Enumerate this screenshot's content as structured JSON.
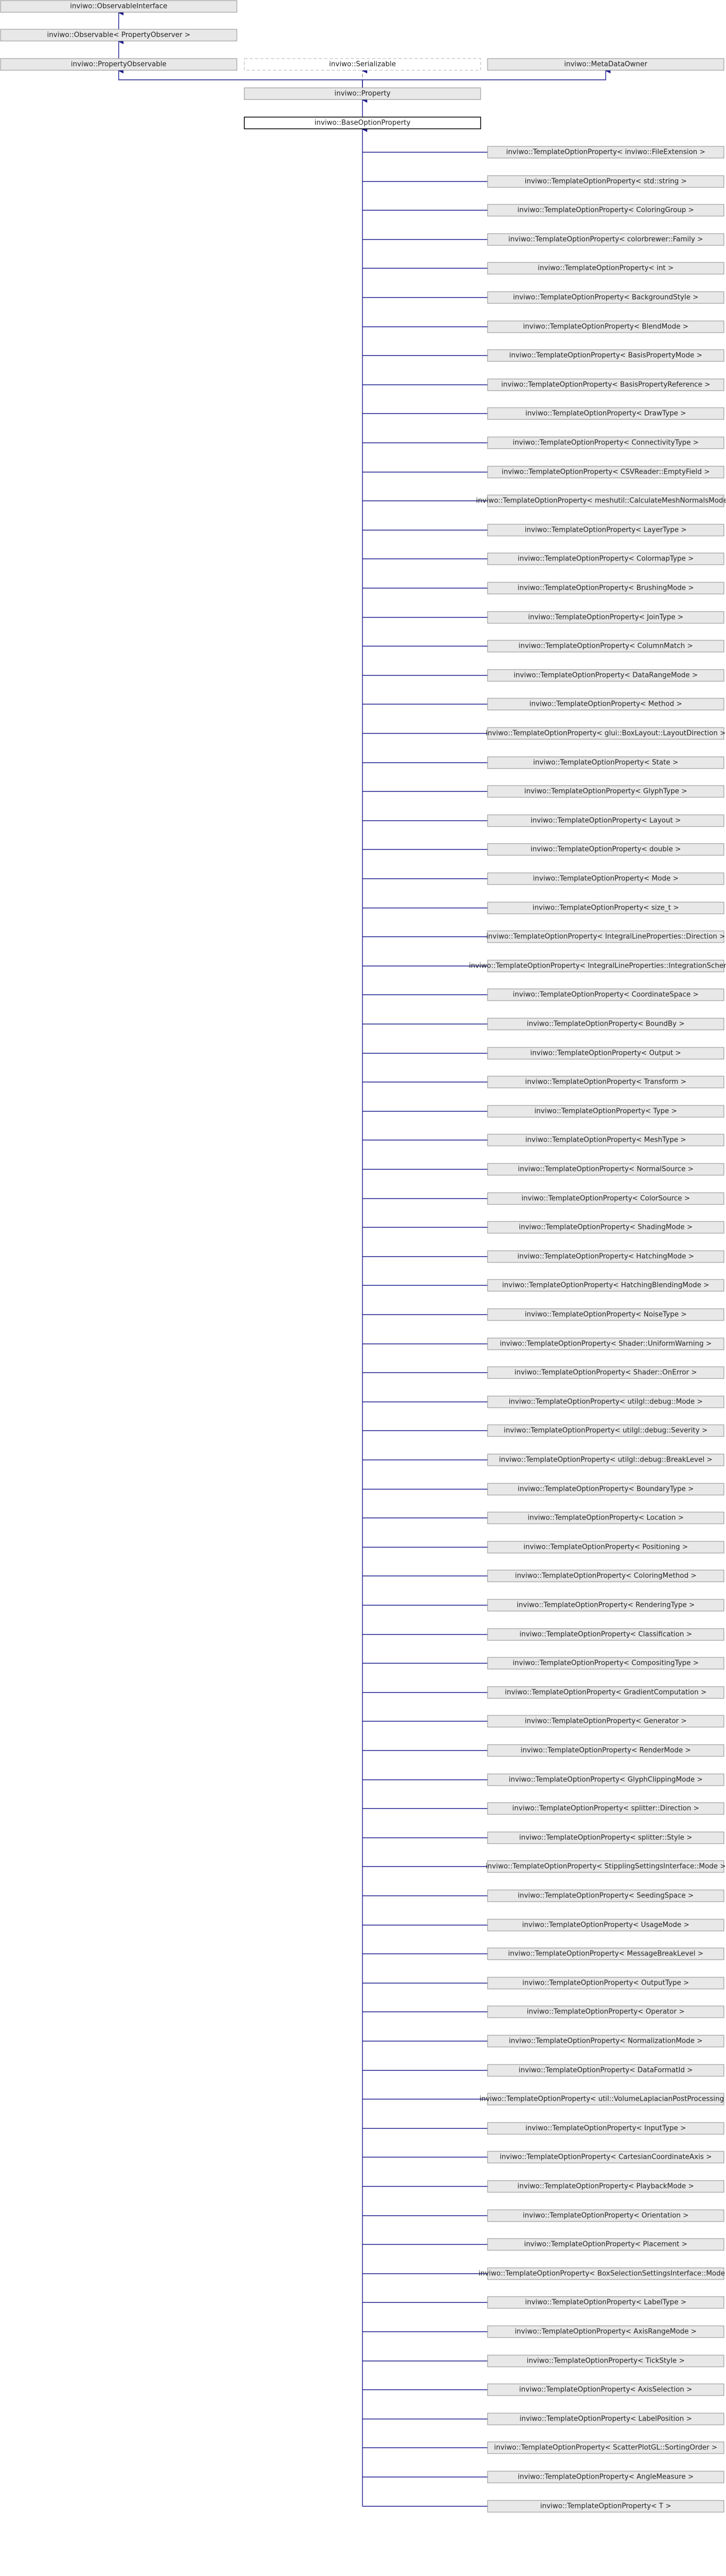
{
  "diagram": {
    "top_nodes": [
      {
        "id": "observable-interface",
        "label": "inviwo::ObservableInterface"
      },
      {
        "id": "observable-property-observer",
        "label": "inviwo::Observable< PropertyObserver >"
      },
      {
        "id": "property-observable",
        "label": "inviwo::PropertyObservable"
      },
      {
        "id": "serializable",
        "label": "inviwo::Serializable"
      },
      {
        "id": "metadata-owner",
        "label": "inviwo::MetaDataOwner"
      },
      {
        "id": "property",
        "label": "inviwo::Property"
      },
      {
        "id": "base-option-property",
        "label": "inviwo::BaseOptionProperty"
      }
    ],
    "derived": [
      "inviwo::TemplateOptionProperty< inviwo::FileExtension >",
      "inviwo::TemplateOptionProperty< std::string >",
      "inviwo::TemplateOptionProperty< ColoringGroup >",
      "inviwo::TemplateOptionProperty< colorbrewer::Family >",
      "inviwo::TemplateOptionProperty< int >",
      "inviwo::TemplateOptionProperty< BackgroundStyle >",
      "inviwo::TemplateOptionProperty< BlendMode >",
      "inviwo::TemplateOptionProperty< BasisPropertyMode >",
      "inviwo::TemplateOptionProperty< BasisPropertyReference >",
      "inviwo::TemplateOptionProperty< DrawType >",
      "inviwo::TemplateOptionProperty< ConnectivityType >",
      "inviwo::TemplateOptionProperty< CSVReader::EmptyField >",
      "inviwo::TemplateOptionProperty< meshutil::CalculateMeshNormalsMode >",
      "inviwo::TemplateOptionProperty< LayerType >",
      "inviwo::TemplateOptionProperty< ColormapType >",
      "inviwo::TemplateOptionProperty< BrushingMode >",
      "inviwo::TemplateOptionProperty< JoinType >",
      "inviwo::TemplateOptionProperty< ColumnMatch >",
      "inviwo::TemplateOptionProperty< DataRangeMode >",
      "inviwo::TemplateOptionProperty< Method >",
      "inviwo::TemplateOptionProperty< glui::BoxLayout::LayoutDirection >",
      "inviwo::TemplateOptionProperty< State >",
      "inviwo::TemplateOptionProperty< GlyphType >",
      "inviwo::TemplateOptionProperty< Layout >",
      "inviwo::TemplateOptionProperty< double >",
      "inviwo::TemplateOptionProperty< Mode >",
      "inviwo::TemplateOptionProperty< size_t >",
      "inviwo::TemplateOptionProperty< IntegralLineProperties::Direction >",
      "inviwo::TemplateOptionProperty< IntegralLineProperties::IntegrationScheme >",
      "inviwo::TemplateOptionProperty< CoordinateSpace >",
      "inviwo::TemplateOptionProperty< BoundBy >",
      "inviwo::TemplateOptionProperty< Output >",
      "inviwo::TemplateOptionProperty< Transform >",
      "inviwo::TemplateOptionProperty< Type >",
      "inviwo::TemplateOptionProperty< MeshType >",
      "inviwo::TemplateOptionProperty< NormalSource >",
      "inviwo::TemplateOptionProperty< ColorSource >",
      "inviwo::TemplateOptionProperty< ShadingMode >",
      "inviwo::TemplateOptionProperty< HatchingMode >",
      "inviwo::TemplateOptionProperty< HatchingBlendingMode >",
      "inviwo::TemplateOptionProperty< NoiseType >",
      "inviwo::TemplateOptionProperty< Shader::UniformWarning >",
      "inviwo::TemplateOptionProperty< Shader::OnError >",
      "inviwo::TemplateOptionProperty< utilgl::debug::Mode >",
      "inviwo::TemplateOptionProperty< utilgl::debug::Severity >",
      "inviwo::TemplateOptionProperty< utilgl::debug::BreakLevel >",
      "inviwo::TemplateOptionProperty< BoundaryType >",
      "inviwo::TemplateOptionProperty< Location >",
      "inviwo::TemplateOptionProperty< Positioning >",
      "inviwo::TemplateOptionProperty< ColoringMethod >",
      "inviwo::TemplateOptionProperty< RenderingType >",
      "inviwo::TemplateOptionProperty< Classification >",
      "inviwo::TemplateOptionProperty< CompositingType >",
      "inviwo::TemplateOptionProperty< GradientComputation >",
      "inviwo::TemplateOptionProperty< Generator >",
      "inviwo::TemplateOptionProperty< RenderMode >",
      "inviwo::TemplateOptionProperty< GlyphClippingMode >",
      "inviwo::TemplateOptionProperty< splitter::Direction >",
      "inviwo::TemplateOptionProperty< splitter::Style >",
      "inviwo::TemplateOptionProperty< StipplingSettingsInterface::Mode >",
      "inviwo::TemplateOptionProperty< SeedingSpace >",
      "inviwo::TemplateOptionProperty< UsageMode >",
      "inviwo::TemplateOptionProperty< MessageBreakLevel >",
      "inviwo::TemplateOptionProperty< OutputType >",
      "inviwo::TemplateOptionProperty< Operator >",
      "inviwo::TemplateOptionProperty< NormalizationMode >",
      "inviwo::TemplateOptionProperty< DataFormatId >",
      "inviwo::TemplateOptionProperty< util::VolumeLaplacianPostProcessing >",
      "inviwo::TemplateOptionProperty< InputType >",
      "inviwo::TemplateOptionProperty< CartesianCoordinateAxis >",
      "inviwo::TemplateOptionProperty< PlaybackMode >",
      "inviwo::TemplateOptionProperty< Orientation >",
      "inviwo::TemplateOptionProperty< Placement >",
      "inviwo::TemplateOptionProperty< BoxSelectionSettingsInterface::Mode >",
      "inviwo::TemplateOptionProperty< LabelType >",
      "inviwo::TemplateOptionProperty< AxisRangeMode >",
      "inviwo::TemplateOptionProperty< TickStyle >",
      "inviwo::TemplateOptionProperty< AxisSelection >",
      "inviwo::TemplateOptionProperty< LabelPosition >",
      "inviwo::TemplateOptionProperty< ScatterPlotGL::SortingOrder >",
      "inviwo::TemplateOptionProperty< AngleMeasure >",
      "inviwo::TemplateOptionProperty< T >"
    ],
    "colors": {
      "edge": "#1d1d8f",
      "node_border": "#8c8c8c",
      "node_fill_grey": "#e8e8e8"
    }
  }
}
